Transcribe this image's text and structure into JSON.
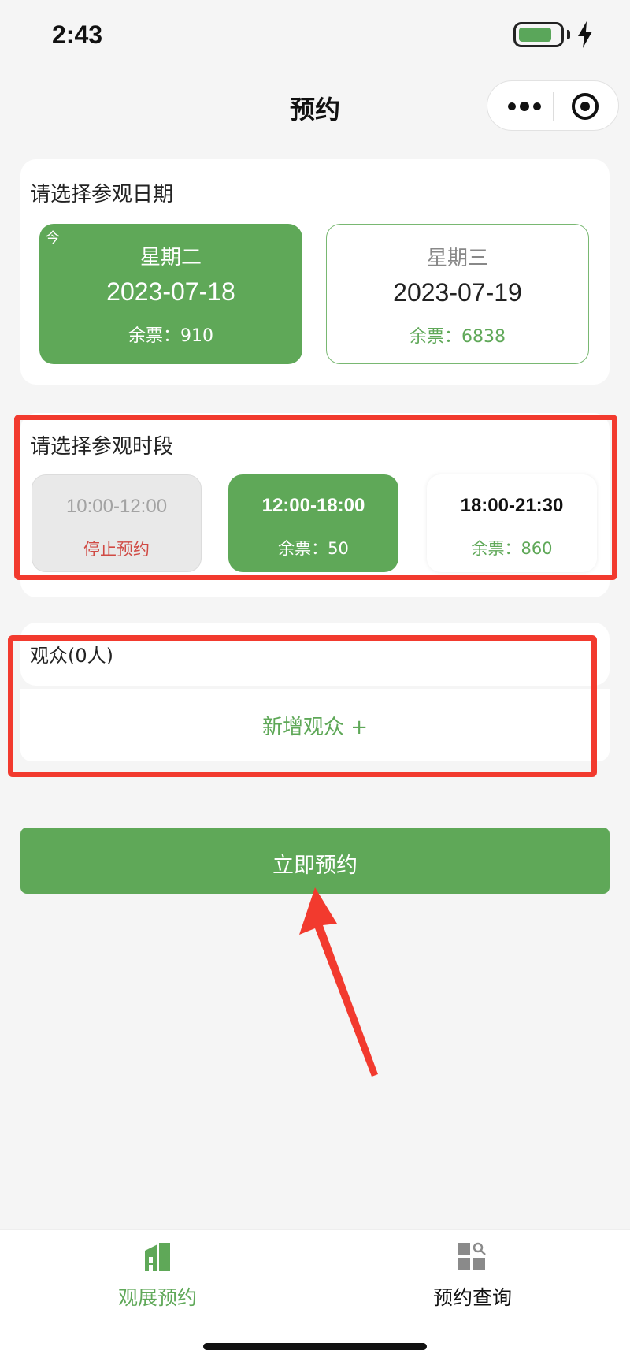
{
  "status_bar": {
    "time": "2:43",
    "battery_level": 0.82,
    "battery_color": "#5aa65a"
  },
  "nav": {
    "title": "预约",
    "more_icon": "more-dots-icon",
    "close_icon": "target-close-icon"
  },
  "date_section": {
    "title": "请选择参观日期",
    "options": [
      {
        "badge": "今",
        "weekday": "星期二",
        "date": "2023-07-18",
        "stock": "余票：910",
        "selected": true
      },
      {
        "badge": "",
        "weekday": "星期三",
        "date": "2023-07-19",
        "stock": "余票：6838",
        "selected": false
      }
    ]
  },
  "slot_section": {
    "title": "请选择参观时段",
    "slots": [
      {
        "time": "10:00-12:00",
        "stock": "停止预约",
        "state": "disabled"
      },
      {
        "time": "12:00-18:00",
        "stock": "余票：50",
        "state": "selected"
      },
      {
        "time": "18:00-21:30",
        "stock": "余票：860",
        "state": "normal"
      }
    ]
  },
  "audience_section": {
    "title": "观众(0人)",
    "add_label": "新增观众 +"
  },
  "submit_label": "立即预约",
  "tab_bar": {
    "items": [
      {
        "label": "观展预约",
        "icon": "building-icon",
        "active": true
      },
      {
        "label": "预约查询",
        "icon": "grid-search-icon",
        "active": false
      }
    ]
  },
  "colors": {
    "accent": "#5fa858",
    "annotation": "#f23a2e",
    "disabled_text": "#d04a44",
    "background": "#f5f5f5"
  }
}
